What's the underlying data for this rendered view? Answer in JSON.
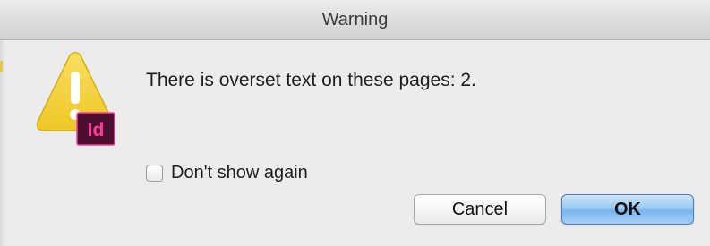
{
  "window": {
    "title": "Warning"
  },
  "icon": {
    "name": "warning-triangle-icon",
    "badge_text": "Id",
    "triangle_color": "#f4d23c",
    "badge_color": "#4b0f30",
    "badge_text_color": "#ff3d9a"
  },
  "message": {
    "text": "There is overset text on these pages: 2."
  },
  "checkbox": {
    "label": "Don't show again",
    "checked": false
  },
  "buttons": {
    "cancel_label": "Cancel",
    "ok_label": "OK"
  },
  "colors": {
    "dialog_bg": "#ececec",
    "ok_accent": "#7cb5ee"
  }
}
